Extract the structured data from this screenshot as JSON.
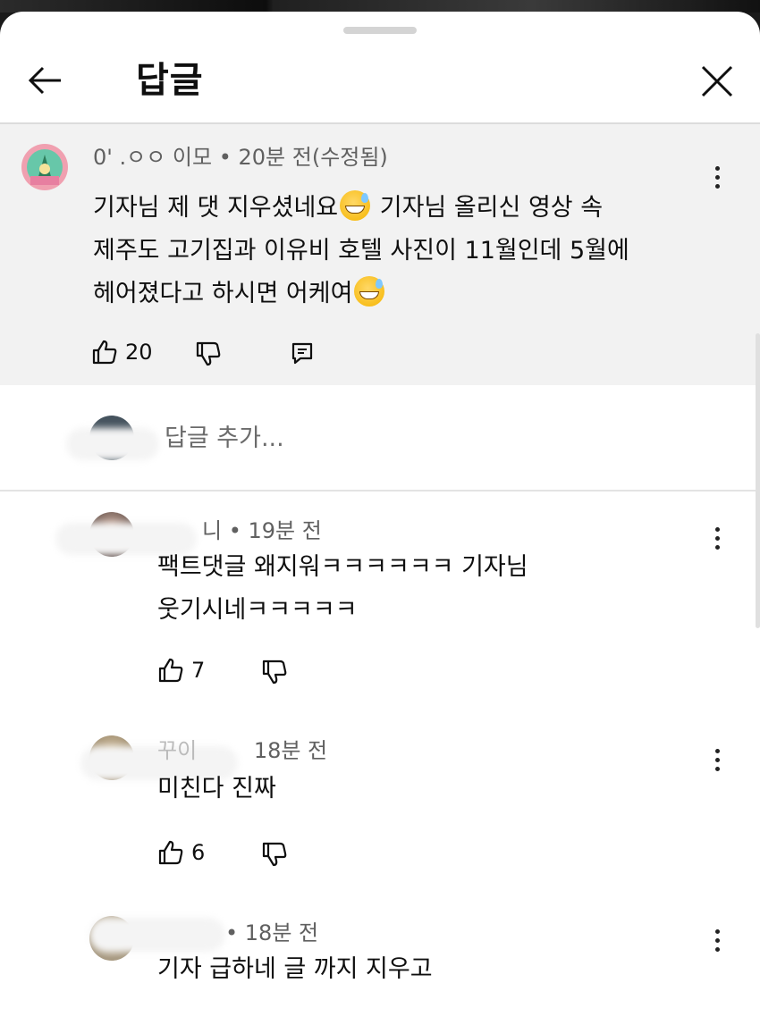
{
  "header": {
    "title": "답글"
  },
  "pinned_comment": {
    "author": "0'  .ㅇㅇ 이모",
    "time": "• 20분 전(수정됨)",
    "text_line1": "기자님 제 댓 지우셨네요",
    "text_line1b": " 기자님 올리신 영상 속",
    "text_line2": "제주도 고기집과 이유비 호텔 사진이 11월인데 5월에",
    "text_line3": "헤어졌다고 하시면 어케여",
    "likes": "20"
  },
  "add_reply": {
    "placeholder": "답글 추가..."
  },
  "replies": [
    {
      "author": "니",
      "time": "• 19분 전",
      "lines": [
        "팩트댓글 왜지워ㅋㅋㅋㅋㅋㅋ 기자님",
        "웃기시네ㅋㅋㅋㅋㅋ"
      ],
      "likes": "7"
    },
    {
      "author": "꾸이",
      "time": "18분 전",
      "lines": [
        "미친다 진짜"
      ],
      "likes": "6"
    },
    {
      "author": "",
      "time": "• 18분 전",
      "lines": [
        "기자 급하네 글 까지 지우고"
      ],
      "likes": ""
    }
  ],
  "colors": {
    "pinned_bg": "#f2f2f2",
    "text": "#0f0f0f",
    "meta": "#606060"
  },
  "icons": [
    "back-arrow-icon",
    "close-icon",
    "thumb-up-icon",
    "thumb-down-icon",
    "reply-icon",
    "more-vert-icon",
    "emoji-sweat-smile-icon"
  ]
}
